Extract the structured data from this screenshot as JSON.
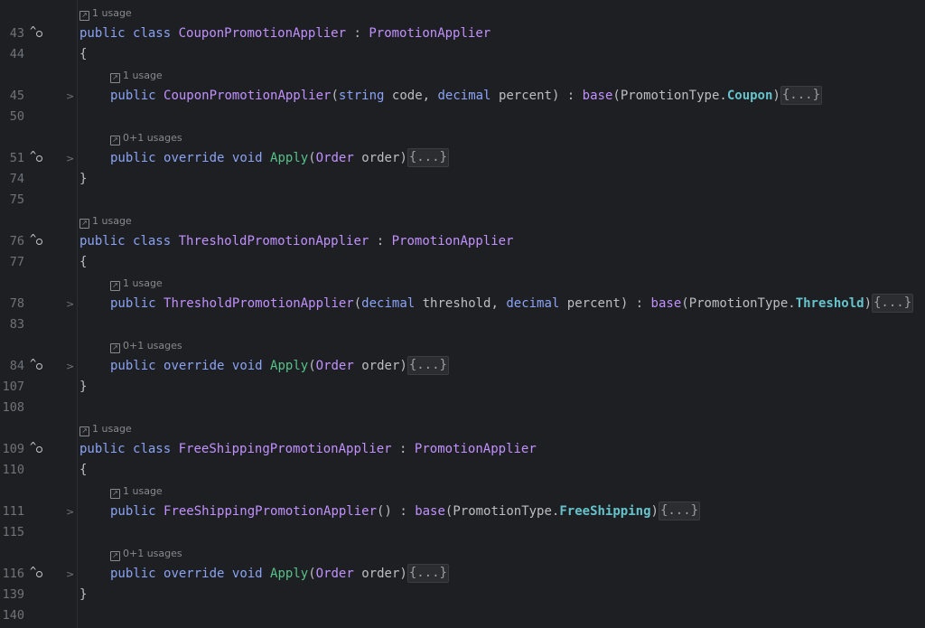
{
  "colors": {
    "background": "#1e1f22",
    "keyword": "#8aa3f5",
    "class_name": "#c191ff",
    "method": "#57c18a",
    "enum_member": "#66c3cc",
    "text": "#bcbec4",
    "line_number": "#6f737a"
  },
  "icons": {
    "implements": "implementation-gutter-icon",
    "fold": "chevron-right-icon",
    "usage": "arrow-up-right-icon"
  },
  "blocks": [
    {
      "class_usage": "1 usage",
      "class_line": "43",
      "class_name": "CouponPromotionApplier",
      "base_class": "PromotionApplier",
      "open_line": "44",
      "ctor_usage": "1 usage",
      "ctor_line": "45",
      "ctor_params": [
        {
          "type": "string",
          "name": "code"
        },
        {
          "type": "decimal",
          "name": "percent"
        }
      ],
      "ctor_base_type": "PromotionType",
      "ctor_base_member": "Coupon",
      "blank_line_1": "50",
      "apply_usage": "0+1 usages",
      "apply_line": "51",
      "close_line": "74",
      "blank_line_2": "75"
    },
    {
      "class_usage": "1 usage",
      "class_line": "76",
      "class_name": "ThresholdPromotionApplier",
      "base_class": "PromotionApplier",
      "open_line": "77",
      "ctor_usage": "1 usage",
      "ctor_line": "78",
      "ctor_params": [
        {
          "type": "decimal",
          "name": "threshold"
        },
        {
          "type": "decimal",
          "name": "percent"
        }
      ],
      "ctor_base_type": "PromotionType",
      "ctor_base_member": "Threshold",
      "blank_line_1": "83",
      "apply_usage": "0+1 usages",
      "apply_line": "84",
      "close_line": "107",
      "blank_line_2": "108"
    },
    {
      "class_usage": "1 usage",
      "class_line": "109",
      "class_name": "FreeShippingPromotionApplier",
      "base_class": "PromotionApplier",
      "open_line": "110",
      "ctor_usage": "1 usage",
      "ctor_line": "111",
      "ctor_params": [],
      "ctor_base_type": "PromotionType",
      "ctor_base_member": "FreeShipping",
      "blank_line_1": "115",
      "apply_usage": "0+1 usages",
      "apply_line": "116",
      "close_line": "139",
      "blank_line_2": "140"
    }
  ],
  "tokens": {
    "public": "public",
    "class": "class",
    "colon": " : ",
    "open_brace": "{",
    "close_brace": "}",
    "override": "override",
    "void": "void",
    "apply_name": "Apply",
    "order_type": "Order",
    "order_param": "order",
    "base": "base",
    "folded": "{...}"
  }
}
